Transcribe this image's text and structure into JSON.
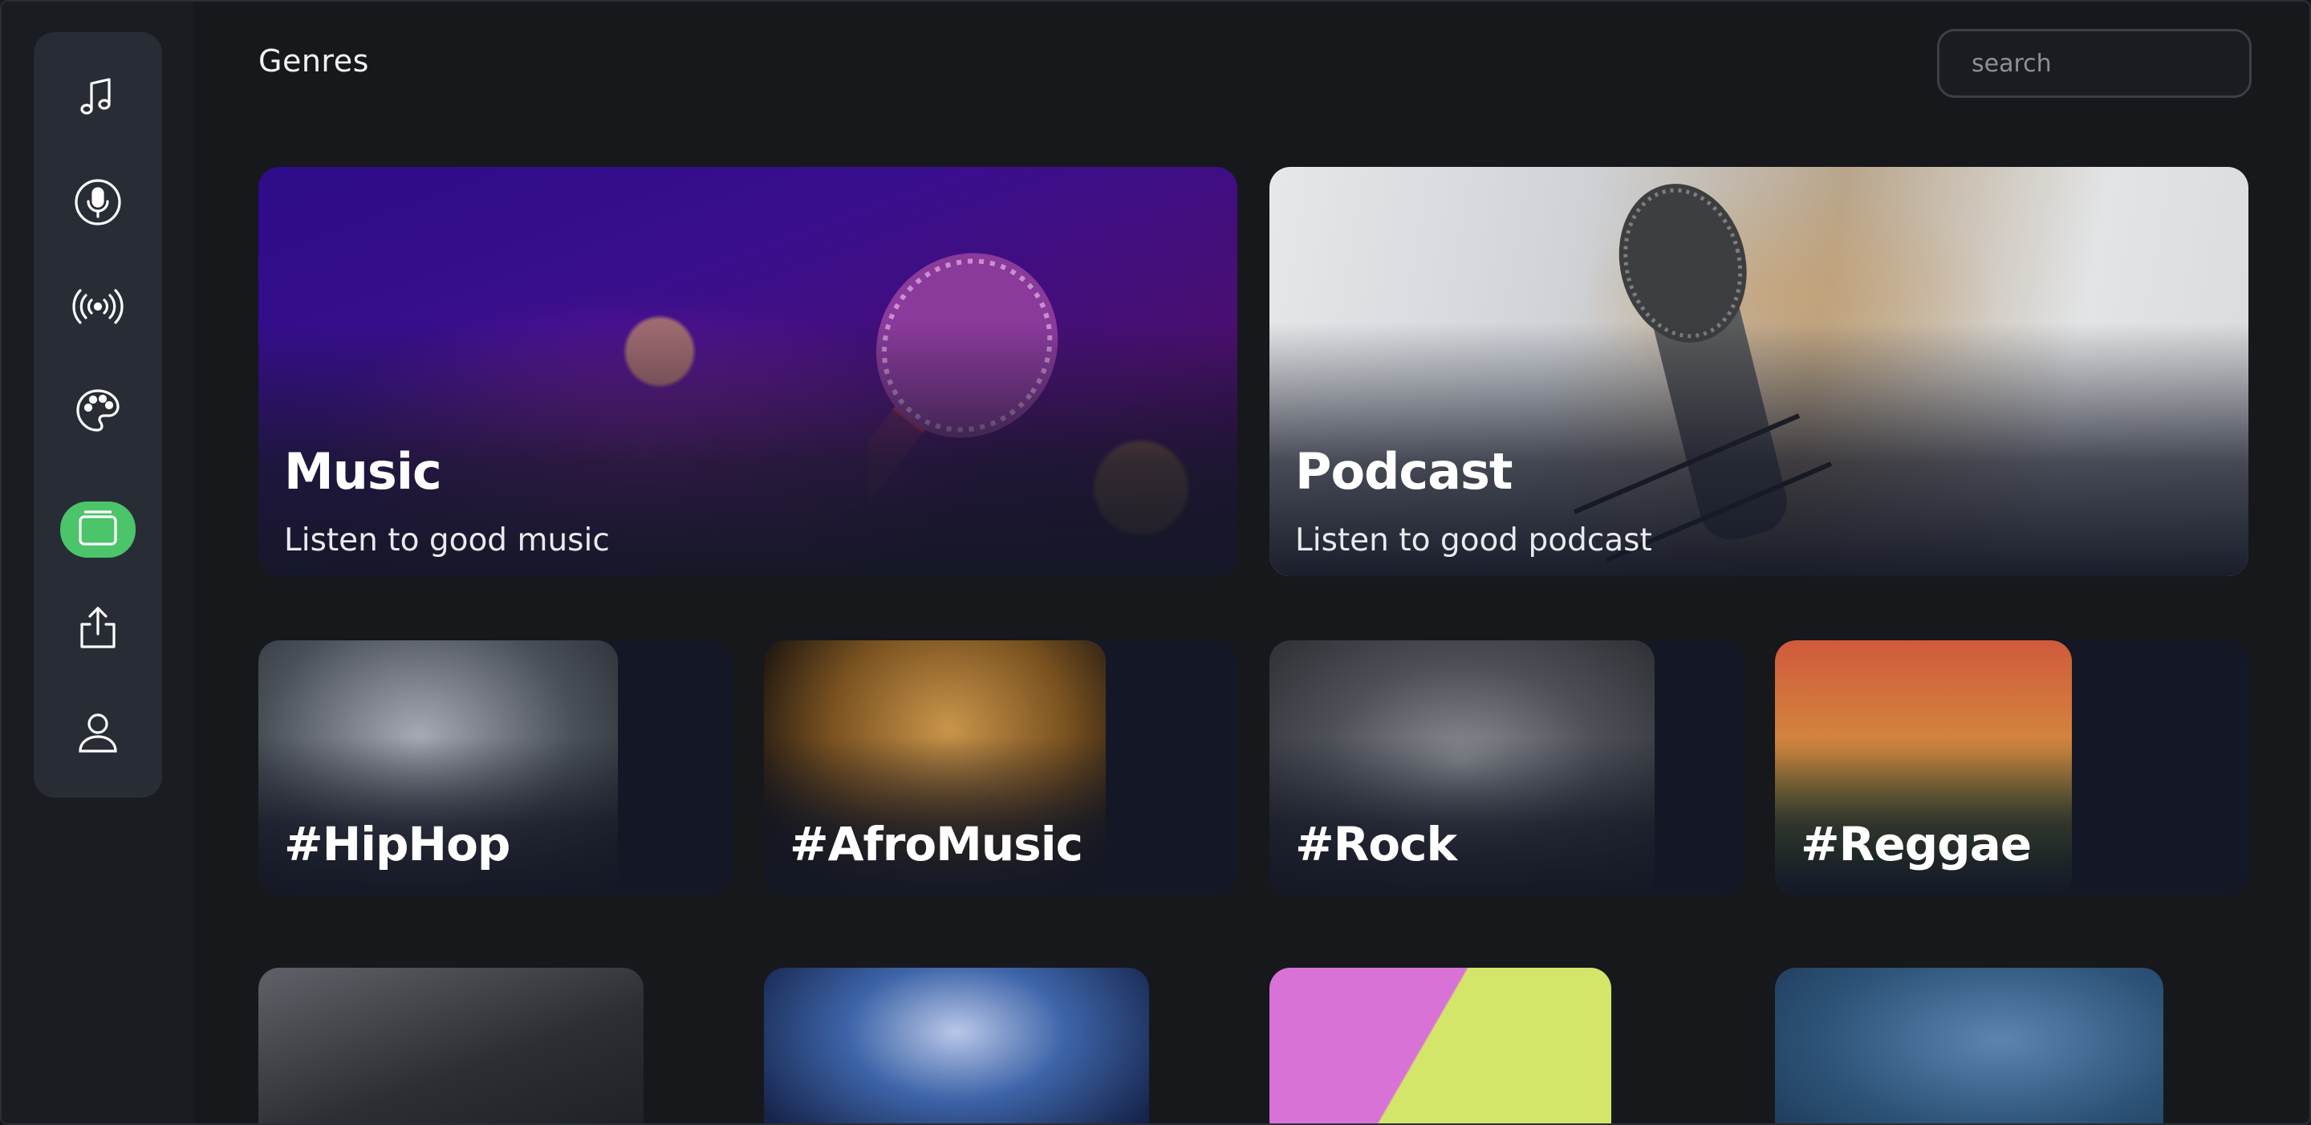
{
  "header": {
    "title": "Genres",
    "search_placeholder": "search"
  },
  "sidebar": {
    "items": [
      {
        "icon": "music-note-icon",
        "active": false
      },
      {
        "icon": "microphone-icon",
        "active": false
      },
      {
        "icon": "broadcast-icon",
        "active": false
      },
      {
        "icon": "palette-icon",
        "active": false
      },
      {
        "icon": "collection-icon",
        "active": true
      },
      {
        "icon": "share-icon",
        "active": false
      },
      {
        "icon": "user-icon",
        "active": false
      }
    ],
    "active_color": "#4bc46a"
  },
  "featured": [
    {
      "title": "Music",
      "subtitle": "Listen to good music"
    },
    {
      "title": "Podcast",
      "subtitle": "Listen to good podcast"
    }
  ],
  "genres": [
    {
      "label": "#HipHop"
    },
    {
      "label": "#AfroMusic"
    },
    {
      "label": "#Rock"
    },
    {
      "label": "#Reggae"
    }
  ],
  "colors": {
    "background": "#16181c",
    "sidebar": "#282c35",
    "card_fade": "#141826"
  }
}
